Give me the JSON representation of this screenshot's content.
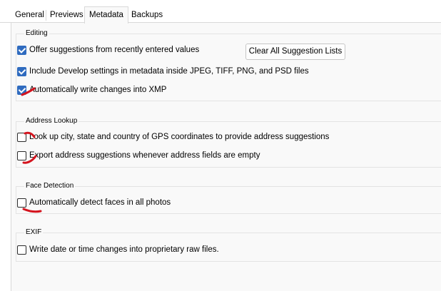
{
  "tabs": [
    {
      "label": "General"
    },
    {
      "label": "Previews"
    },
    {
      "label": "Metadata"
    },
    {
      "label": "Backups"
    }
  ],
  "active_tab": "Metadata",
  "groups": {
    "editing": {
      "title": "Editing",
      "items": [
        {
          "label": "Offer suggestions from recently entered values",
          "checked": true
        },
        {
          "label": "Include Develop settings in metadata inside JPEG, TIFF, PNG, and PSD files",
          "checked": true
        },
        {
          "label": "Automatically write changes into XMP",
          "checked": true
        }
      ],
      "button_label": "Clear All Suggestion Lists"
    },
    "address_lookup": {
      "title": "Address Lookup",
      "items": [
        {
          "label": "Look up city, state and country of GPS coordinates to provide address suggestions",
          "checked": false
        },
        {
          "label": "Export address suggestions whenever address fields are empty",
          "checked": false
        }
      ]
    },
    "face_detection": {
      "title": "Face Detection",
      "items": [
        {
          "label": "Automatically detect faces in all photos",
          "checked": false
        }
      ]
    },
    "exif": {
      "title": "EXIF",
      "items": [
        {
          "label": "Write date or time changes into proprietary raw files.",
          "checked": false
        }
      ]
    }
  },
  "colors": {
    "checkbox_checked": "#2f6bbf",
    "annotation_red": "#d4141e",
    "panel_bg": "#f9f9f9"
  },
  "annotation_marks": {
    "color": "#d4141e",
    "count": 5,
    "description_of_mark": "hand-drawn red squiggles next to checkboxes"
  }
}
